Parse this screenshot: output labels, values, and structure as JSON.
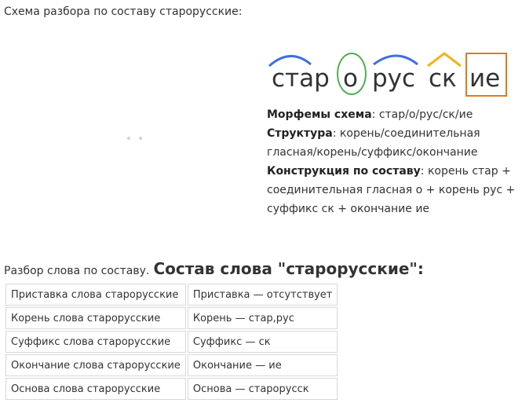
{
  "scheme_title": "Схема разбора по составу старорусские:",
  "word_scheme": {
    "morphemes": [
      {
        "text": "стар",
        "type": "root"
      },
      {
        "text": "о",
        "type": "connecting_vowel"
      },
      {
        "text": "рус",
        "type": "root"
      },
      {
        "text": "ск",
        "type": "suffix"
      },
      {
        "text": "ие",
        "type": "ending"
      }
    ],
    "colors": {
      "root": "#3f6fe0",
      "connecting_vowel": "#4caf50",
      "suffix": "#f2b418",
      "ending": "#e07a1f"
    }
  },
  "info": {
    "morphemes_label": "Морфемы схема",
    "morphemes_value": ": стар/о/рус/ск/ие",
    "structure_label": "Структура",
    "structure_value": ": корень/соединительная гласная/корень/суффикс/окончание",
    "construction_label": "Конструкция по составу",
    "construction_value": ": корень стар + соединительная гласная о + корень рус + суффикс ск + окончание ие"
  },
  "analysis": {
    "intro": "Разбор слова по составу.",
    "heading": "Состав слова \"старорусские\":"
  },
  "table": {
    "rows": [
      [
        "Приставка слова старорусские",
        "Приставка — отсутствует"
      ],
      [
        "Корень слова старорусские",
        "Корень — стар,рус"
      ],
      [
        "Суффикс слова старорусские",
        "Суффикс — ск"
      ],
      [
        "Окончание слова старорусские",
        "Окончание — ие"
      ],
      [
        "Основа слова старорусские",
        "Основа — старорусск"
      ]
    ]
  }
}
